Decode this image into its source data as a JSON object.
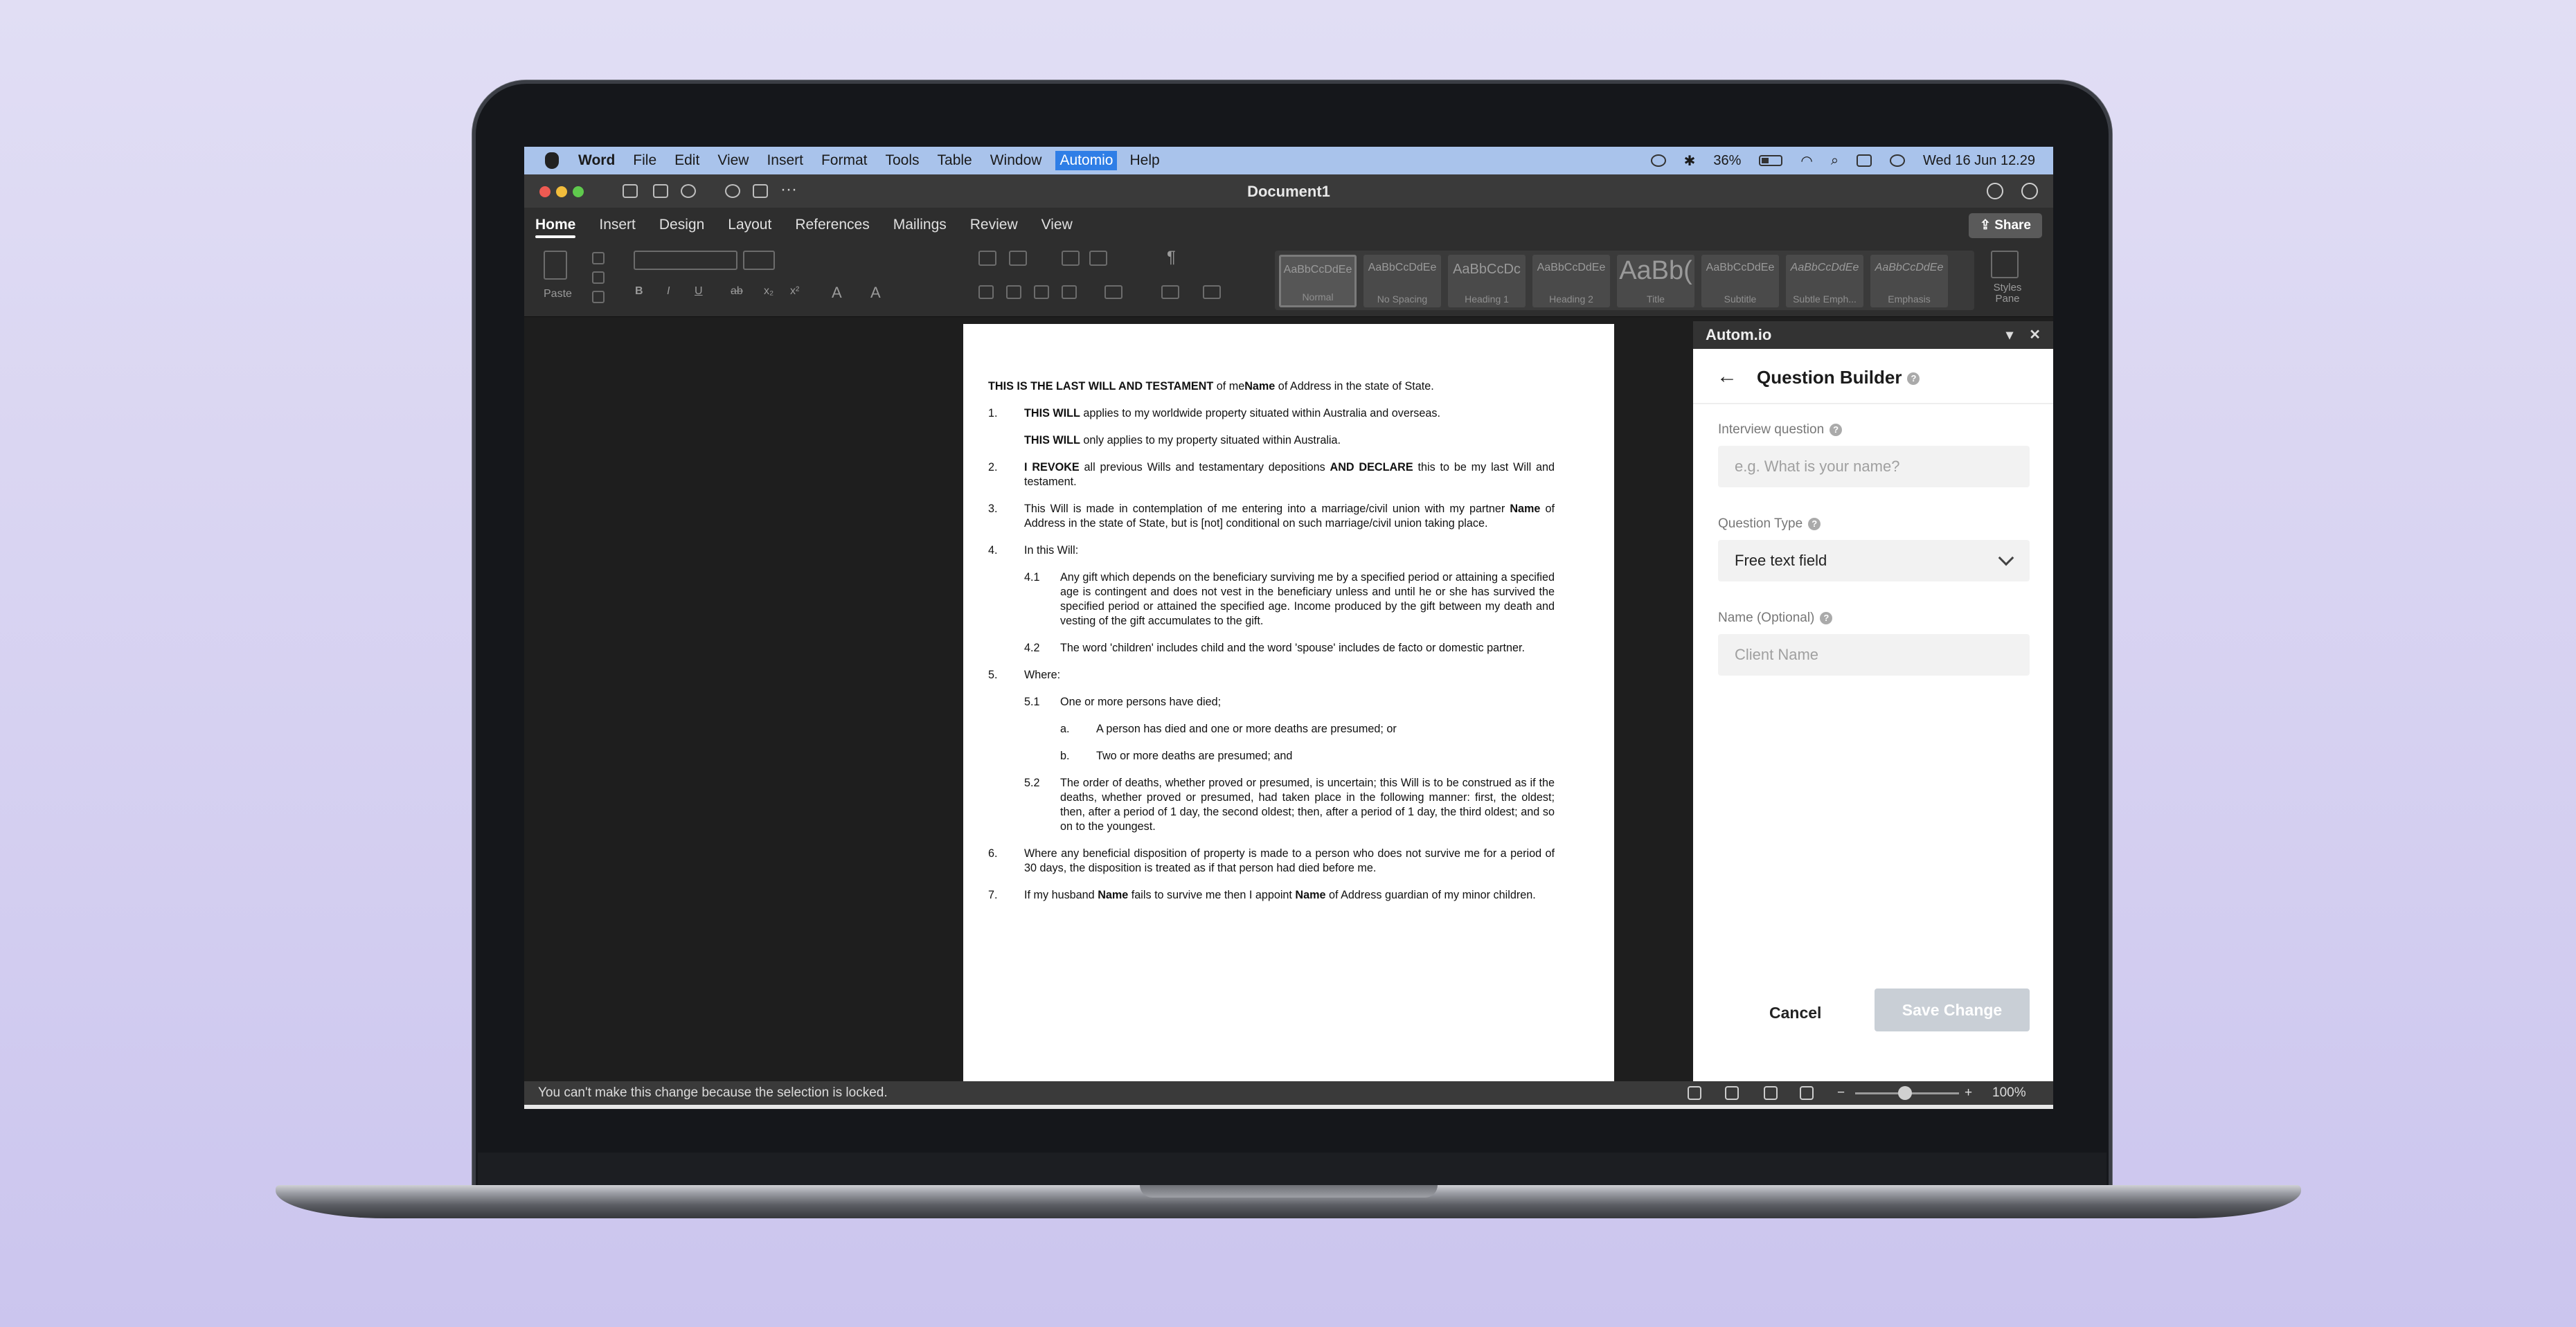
{
  "menubar": {
    "items": [
      "Word",
      "File",
      "Edit",
      "View",
      "Insert",
      "Format",
      "Tools",
      "Table",
      "Window",
      "Automio",
      "Help"
    ],
    "battery": "36%",
    "datetime": "Wed 16 Jun  12.29"
  },
  "window": {
    "title": "Document1"
  },
  "ribbon": {
    "tabs": [
      "Home",
      "Insert",
      "Design",
      "Layout",
      "References",
      "Mailings",
      "Review",
      "View"
    ],
    "share": "Share",
    "paste": "Paste",
    "styles": [
      {
        "sample": "AaBbCcDdEe",
        "name": "Normal"
      },
      {
        "sample": "AaBbCcDdEe",
        "name": "No Spacing"
      },
      {
        "sample": "AaBbCcDc",
        "name": "Heading 1"
      },
      {
        "sample": "AaBbCcDdEe",
        "name": "Heading 2"
      },
      {
        "sample": "AaBb(",
        "name": "Title"
      },
      {
        "sample": "AaBbCcDdEe",
        "name": "Subtitle"
      },
      {
        "sample": "AaBbCcDdEe",
        "name": "Subtle Emph..."
      },
      {
        "sample": "AaBbCcDdEe",
        "name": "Emphasis"
      }
    ],
    "styles_pane": "Styles Pane"
  },
  "document": {
    "intro_bold": "THIS IS THE LAST WILL AND TESTAMENT",
    "intro_a": " of me",
    "intro_name": "Name",
    "intro_b": " of Address in the state of State.",
    "p1_n": "1.",
    "p1_bold": "THIS WILL",
    "p1_text": " applies to my worldwide property situated within Australia and overseas.",
    "p1b_bold": "THIS WILL",
    "p1b_text": " only applies to my property situated within Australia.",
    "p2_n": "2.",
    "p2_bold1": "I REVOKE",
    "p2_text1": " all previous Wills and testamentary depositions ",
    "p2_bold2": "AND DECLARE",
    "p2_text2": " this to be my last Will and testament.",
    "p3_n": "3.",
    "p3_text1": "This Will is made in contemplation of me entering into a marriage/civil union with my partner ",
    "p3_name": "Name",
    "p3_text2": " of Address in the state of State, but is [not] conditional on such marriage/civil union taking place.",
    "p4_n": "4.",
    "p4_text": "In this Will:",
    "p41_n": "4.1",
    "p41_text": "Any gift which depends on the beneficiary surviving me by a specified period or attaining a specified age is contingent and does not vest in the beneficiary unless and until he or she has survived the specified period or attained the specified age. Income produced by the gift between my death and vesting of the gift accumulates to the gift.",
    "p42_n": "4.2",
    "p42_text": "The word 'children' includes child and the word 'spouse' includes de facto or domestic partner.",
    "p5_n": "5.",
    "p5_text": "Where:",
    "p51_n": "5.1",
    "p51_text": "One or more persons have died;",
    "pa_n": "a.",
    "pa_text": "A person has died and one or more deaths are presumed; or",
    "pb_n": "b.",
    "pb_text": "Two or more deaths are presumed; and",
    "p52_n": "5.2",
    "p52_text": "The order of deaths, whether proved or presumed, is uncertain; this Will is to be construed as if the deaths, whether proved or presumed, had taken place in the following manner: first, the oldest; then, after a period of 1 day, the second oldest; then, after a period of 1 day, the third oldest; and so on to the youngest.",
    "p6_n": "6.",
    "p6_text": "Where any beneficial disposition of property is made to a person who does not survive me for a period of 30 days, the disposition is treated as if that person had died before me.",
    "p7_n": "7.",
    "p7_text1": "If my husband ",
    "p7_name1": "Name",
    "p7_text2": " fails to survive me then I appoint ",
    "p7_name2": "Name",
    "p7_text3": " of Address guardian of my minor children."
  },
  "panel": {
    "title": "Autom.io",
    "heading": "Question Builder",
    "interview_label": "Interview question",
    "interview_placeholder": "e.g. What is your name?",
    "type_label": "Question Type",
    "type_value": "Free text field",
    "name_label": "Name (Optional)",
    "name_placeholder": "Client Name",
    "cancel": "Cancel",
    "save": "Save Change"
  },
  "status": {
    "message": "You can't make this change because the selection is locked.",
    "zoom": "100%"
  }
}
